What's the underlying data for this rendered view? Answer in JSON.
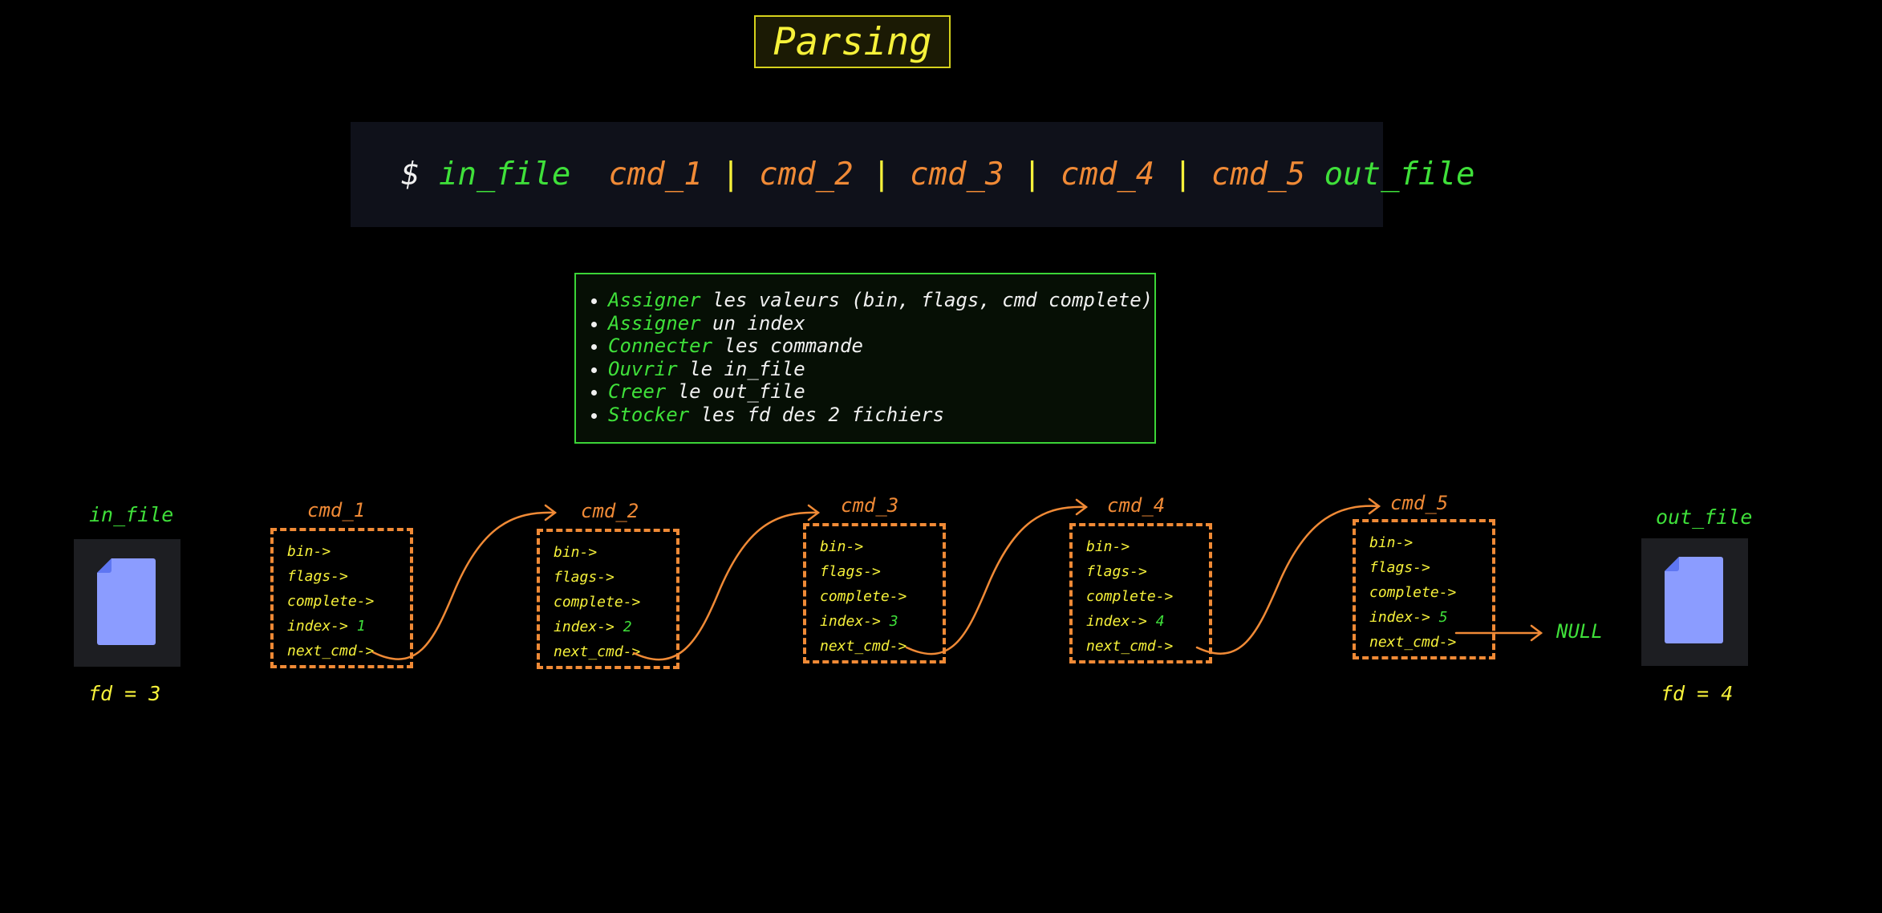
{
  "title": "Parsing",
  "command_line": {
    "prompt": "$",
    "in_file": "in_file",
    "cmds": [
      "cmd_1",
      "cmd_2",
      "cmd_3",
      "cmd_4",
      "cmd_5"
    ],
    "pipe": "|",
    "out_file": "out_file"
  },
  "steps": [
    {
      "verb": "Assigner",
      "rest": " les valeurs (bin, flags, cmd complete)"
    },
    {
      "verb": "Assigner",
      "rest": " un index"
    },
    {
      "verb": "Connecter",
      "rest": " les commande"
    },
    {
      "verb": "Ouvrir",
      "rest": " le in_file"
    },
    {
      "verb": "Creer",
      "rest": " le out_file"
    },
    {
      "verb": "Stocker",
      "rest": " les fd des 2 fichiers"
    }
  ],
  "in_file": {
    "label": "in_file",
    "fd": "fd = 3",
    "icon": "file-icon"
  },
  "out_file": {
    "label": "out_file",
    "fd": "fd = 4",
    "icon": "file-icon"
  },
  "fields": {
    "bin": "bin->",
    "flags": "flags->",
    "complete": "complete->",
    "index": "index->",
    "next": "next_cmd->"
  },
  "nodes": [
    {
      "label": "cmd_1",
      "index": "1"
    },
    {
      "label": "cmd_2",
      "index": "2"
    },
    {
      "label": "cmd_3",
      "index": "3"
    },
    {
      "label": "cmd_4",
      "index": "4"
    },
    {
      "label": "cmd_5",
      "index": "5"
    }
  ],
  "null_label": "NULL",
  "colors": {
    "green": "#3fe03a",
    "orange": "#f08a36",
    "yellow": "#f6f13a",
    "file_icon": "#8b9cff"
  }
}
